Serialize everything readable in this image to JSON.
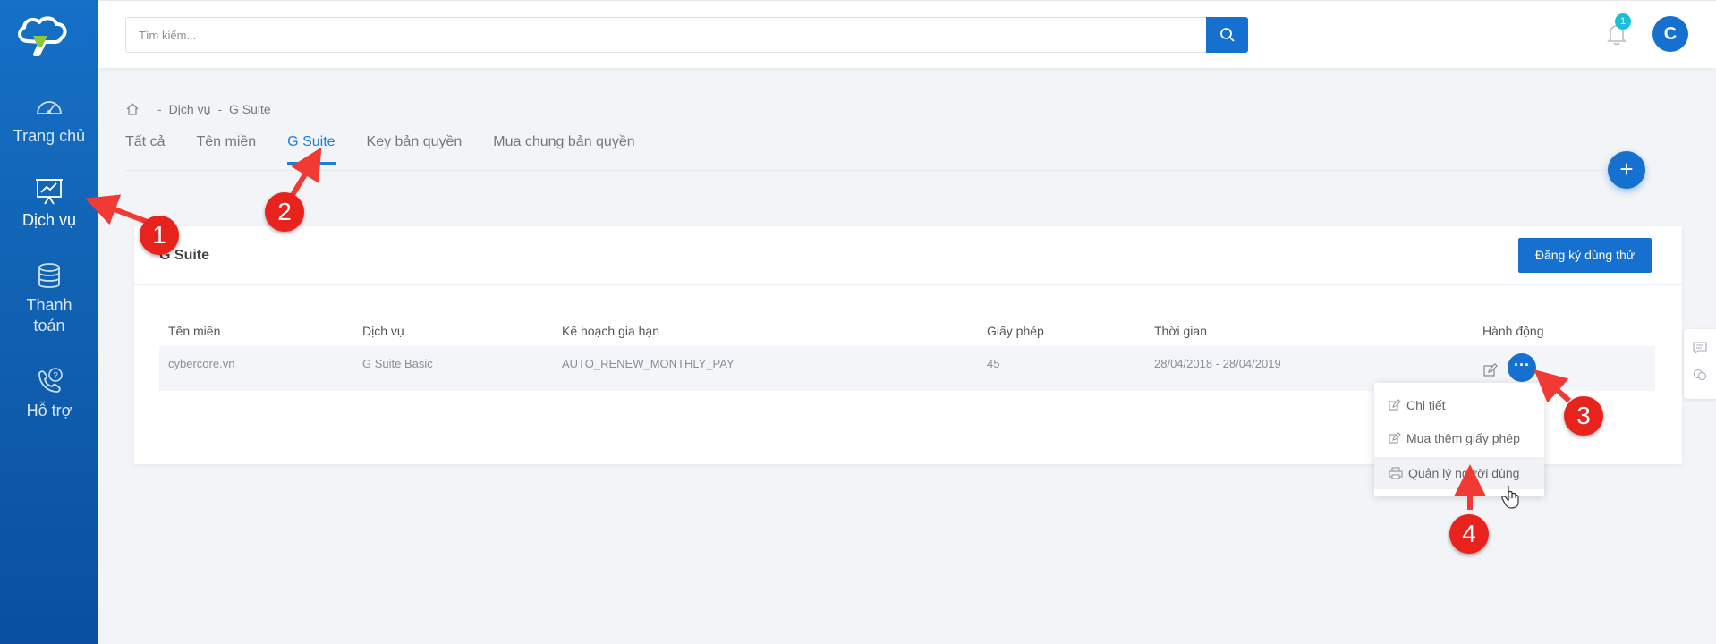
{
  "sidebar": {
    "items": [
      {
        "label": "Trang chủ",
        "icon": "dashboard-gauge-icon"
      },
      {
        "label": "Dịch vụ",
        "icon": "presentation-chart-icon"
      },
      {
        "label": "Thanh toán",
        "icon": "coins-stack-icon"
      },
      {
        "label": "Hỗ trợ",
        "icon": "support-phone-icon"
      }
    ],
    "active": "Dịch vụ"
  },
  "header": {
    "search_placeholder": "Tìm kiếm...",
    "notification_count": "1",
    "avatar_initial": "C"
  },
  "breadcrumb": {
    "items": [
      "Dịch vụ",
      "G Suite"
    ],
    "separator": "-"
  },
  "tabs": [
    {
      "label": "Tất cả"
    },
    {
      "label": "Tên miền"
    },
    {
      "label": "G Suite",
      "active": true
    },
    {
      "label": "Key bản quyền"
    },
    {
      "label": "Mua chung bản quyền"
    }
  ],
  "fab_label": "+",
  "card": {
    "title": "G Suite",
    "trial_button": "Đăng ký dùng thử",
    "columns": [
      "Tên miền",
      "Dịch vụ",
      "Kế hoạch gia hạn",
      "Giấy phép",
      "Thời gian",
      "Hành động"
    ],
    "rows": [
      {
        "domain": "cybercore.vn",
        "service": "G Suite Basic",
        "plan": "AUTO_RENEW_MONTHLY_PAY",
        "licenses": "45",
        "period": "28/04/2018 - 28/04/2019"
      }
    ],
    "more_button": "···"
  },
  "dropdown": {
    "items": [
      {
        "label": "Chi tiết",
        "icon": "edit-icon"
      },
      {
        "label": "Mua thêm giấy phép",
        "icon": "edit-icon"
      },
      {
        "label": "Quản lý người dùng",
        "icon": "printer-icon"
      }
    ],
    "hovered": "Quản lý người dùng"
  },
  "annotations": [
    "1",
    "2",
    "3",
    "4"
  ],
  "colors": {
    "primary": "#1670cf",
    "accent_tab": "#1d7ed8",
    "annotation_red": "#e8221c",
    "badge": "#19c0d6"
  }
}
